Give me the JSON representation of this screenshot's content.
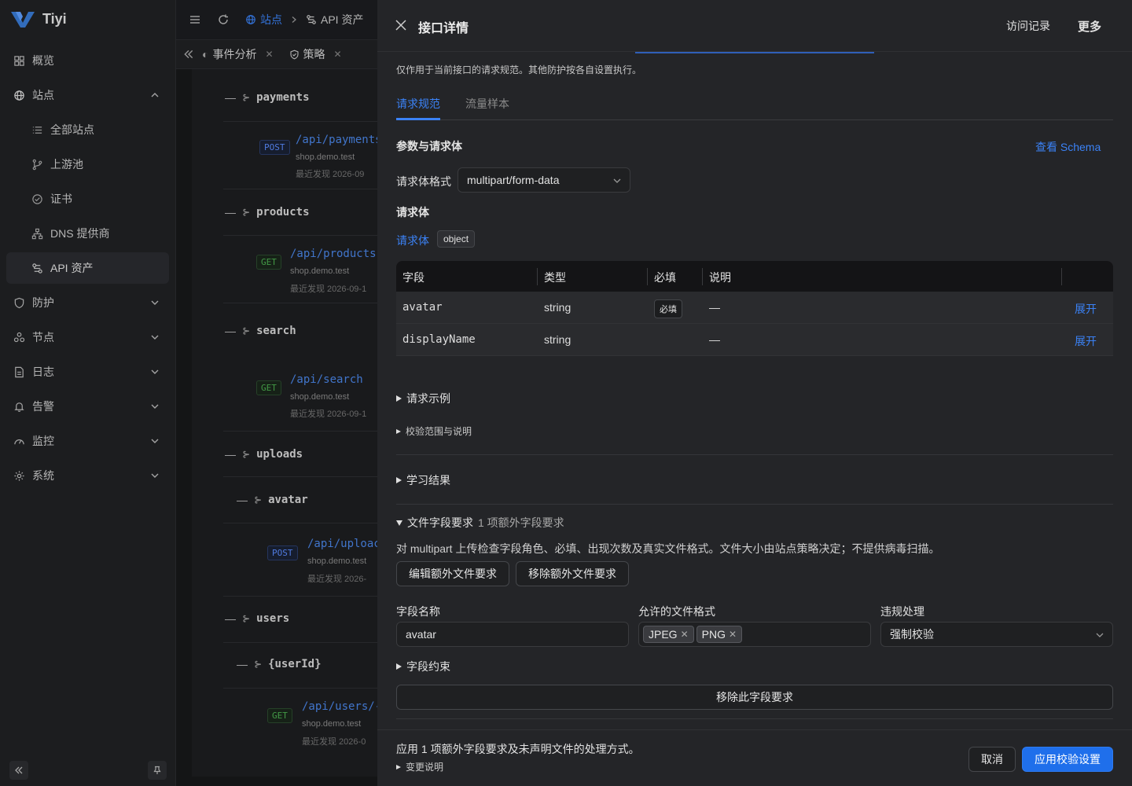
{
  "app": {
    "name": "Tiyi"
  },
  "sidebar": {
    "items": [
      {
        "label": "概览",
        "icon": "dashboard-icon"
      },
      {
        "label": "站点",
        "icon": "globe-icon"
      },
      {
        "label": "全部站点",
        "icon": "list-icon"
      },
      {
        "label": "上游池",
        "icon": "branch-icon"
      },
      {
        "label": "证书",
        "icon": "check-circle-icon"
      },
      {
        "label": "DNS 提供商",
        "icon": "network-icon"
      },
      {
        "label": "API 资产",
        "icon": "api-icon"
      },
      {
        "label": "防护",
        "icon": "shield-icon"
      },
      {
        "label": "节点",
        "icon": "nodes-icon"
      },
      {
        "label": "日志",
        "icon": "file-icon"
      },
      {
        "label": "告警",
        "icon": "bell-icon"
      },
      {
        "label": "监控",
        "icon": "gauge-icon"
      },
      {
        "label": "系统",
        "icon": "gear-icon"
      }
    ]
  },
  "background": {
    "breadcrumb": [
      "站点",
      "API 资产"
    ],
    "tabs": [
      {
        "label": "事件分析"
      },
      {
        "label": "策略"
      }
    ],
    "tree": {
      "payments": "payments",
      "payments_method": "POST",
      "payments_path": "/api/payments",
      "host": "shop.demo.test",
      "seen1": "最近发现 2026-09",
      "products": "products",
      "products_method": "GET",
      "products_path": "/api/products",
      "seen2": "最近发现 2026-09-1",
      "search": "search",
      "search_method": "GET",
      "search_path": "/api/search",
      "seen3": "最近发现 2026-09-1",
      "uploads": "uploads",
      "avatar": "avatar",
      "avatar_method": "POST",
      "avatar_path": "/api/uploac",
      "seen4": "最近发现 2026-",
      "users": "users",
      "userId": "{userId}",
      "users_method": "GET",
      "users_path": "/api/users/-",
      "seen5": "最近发现 2026-0"
    }
  },
  "drawer": {
    "title": "接口详情",
    "history_label": "访问记录",
    "more_label": "更多",
    "note": "仅作用于当前接口的请求规范。其他防护按各自设置执行。",
    "tabs": [
      {
        "label": "请求规范"
      },
      {
        "label": "流量样本"
      }
    ],
    "params_title": "参数与请求体",
    "view_schema": "查看 Schema",
    "body_format_label": "请求体格式",
    "body_format_value": "multipart/form-data",
    "body_title": "请求体",
    "body_link": "请求体",
    "body_type": "object",
    "table": {
      "headers": [
        "字段",
        "类型",
        "必填",
        "说明"
      ],
      "rows": [
        {
          "field": "avatar",
          "type": "string",
          "required": "必填",
          "desc": "—",
          "action": "展开"
        },
        {
          "field": "displayName",
          "type": "string",
          "required": "",
          "desc": "—",
          "action": "展开"
        }
      ]
    },
    "request_example": "请求示例",
    "scope_note": "校验范围与说明",
    "learning": "学习结果",
    "file_req_title": "文件字段要求",
    "file_req_count": "1 项额外字段要求",
    "file_req_desc": "对 multipart 上传检查字段角色、必填、出现次数及真实文件格式。文件大小由站点策略决定；不提供病毒扫描。",
    "edit_btn": "编辑额外文件要求",
    "remove_btn": "移除额外文件要求",
    "field_name_label": "字段名称",
    "field_name_value": "avatar",
    "formats_label": "允许的文件格式",
    "formats": [
      "JPEG",
      "PNG"
    ],
    "violation_label": "违规处理",
    "violation_value": "强制校验",
    "constraints": "字段约束",
    "remove_field_btn": "移除此字段要求",
    "footer_text": "应用 1 项额外字段要求及未声明文件的处理方式。",
    "change_note": "变更说明",
    "cancel": "取消",
    "apply": "应用校验设置"
  },
  "colors": {
    "accent": "#3b82f6",
    "primary_button": "#1f6feb",
    "post": "#5b8cff",
    "get": "#4caf50"
  }
}
